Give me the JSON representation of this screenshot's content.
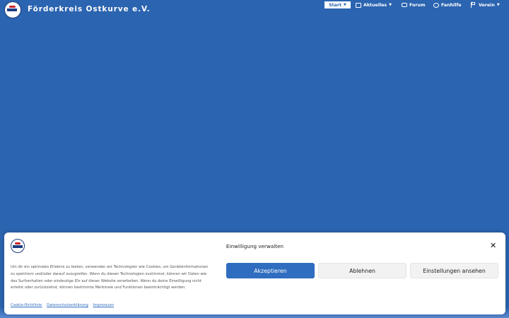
{
  "header": {
    "brand": "Förderkreis Ostkurve e.V.",
    "nav": [
      {
        "label": "Start"
      },
      {
        "label": "Aktuelles"
      },
      {
        "label": "Forum"
      },
      {
        "label": "Fanhilfe"
      },
      {
        "label": "Verein"
      }
    ],
    "colors": {
      "background": "#2b64b0",
      "nav_active_bg": "#ffffff"
    }
  },
  "cookie_banner": {
    "title": "Einwilligung verwalten",
    "text": "Um dir ein optimales Erlebnis zu bieten, verwenden wir Technologien wie Cookies, um Geräteinformationen zu speichern und/oder darauf zuzugreifen. Wenn du diesen Technologien zustimmst, können wir Daten wie das Surfverhalten oder eindeutige IDs auf dieser Website verarbeiten. Wenn du deine Einwilligung nicht erteilst oder zurückziehst, können bestimmte Merkmale und Funktionen beeinträchtigt werden.",
    "buttons": {
      "accept": "Akzeptieren",
      "deny": "Ablehnen",
      "settings": "Einstellungen ansehen"
    },
    "links": [
      "Cookie-Richtlinie",
      "Datenschutzerklärung",
      "Impressum"
    ],
    "colors": {
      "accept": "#2e6dbf"
    }
  }
}
